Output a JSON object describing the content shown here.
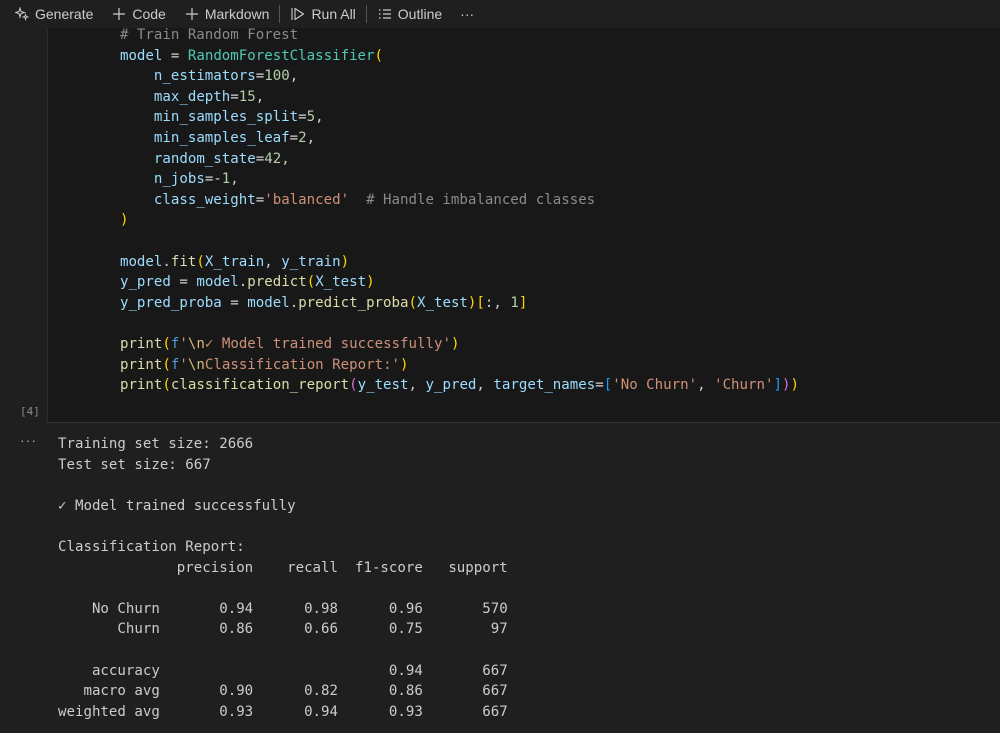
{
  "toolbar": {
    "generate_label": "Generate",
    "code_label": "Code",
    "markdown_label": "Markdown",
    "run_all_label": "Run All",
    "outline_label": "Outline",
    "more_label": "···"
  },
  "cell": {
    "execution_count": "[4]",
    "code_lines": [
      "    # Train Random Forest",
      "    model = RandomForestClassifier(",
      "        n_estimators=100,",
      "        max_depth=15,",
      "        min_samples_split=5,",
      "        min_samples_leaf=2,",
      "        random_state=42,",
      "        n_jobs=-1,",
      "        class_weight='balanced'  # Handle imbalanced classes",
      "    )",
      "",
      "    model.fit(X_train, y_train)",
      "    y_pred = model.predict(X_test)",
      "    y_pred_proba = model.predict_proba(X_test)[:, 1]",
      "",
      "    print(f'\\n✓ Model trained successfully')",
      "    print(f'\\nClassification Report:')",
      "    print(classification_report(y_test, y_pred, target_names=['No Churn', 'Churn']))"
    ]
  },
  "output": {
    "toggle_label": "···",
    "lines": [
      "Training set size: 2666",
      "Test set size: 667",
      "",
      "✓ Model trained successfully",
      "",
      "Classification Report:",
      "              precision    recall  f1-score   support",
      "",
      "    No Churn       0.94      0.98      0.96       570",
      "       Churn       0.86      0.66      0.75        97",
      "",
      "    accuracy                           0.94       667",
      "   macro avg       0.90      0.82      0.86       667",
      "weighted avg       0.93      0.94      0.93       667"
    ]
  }
}
